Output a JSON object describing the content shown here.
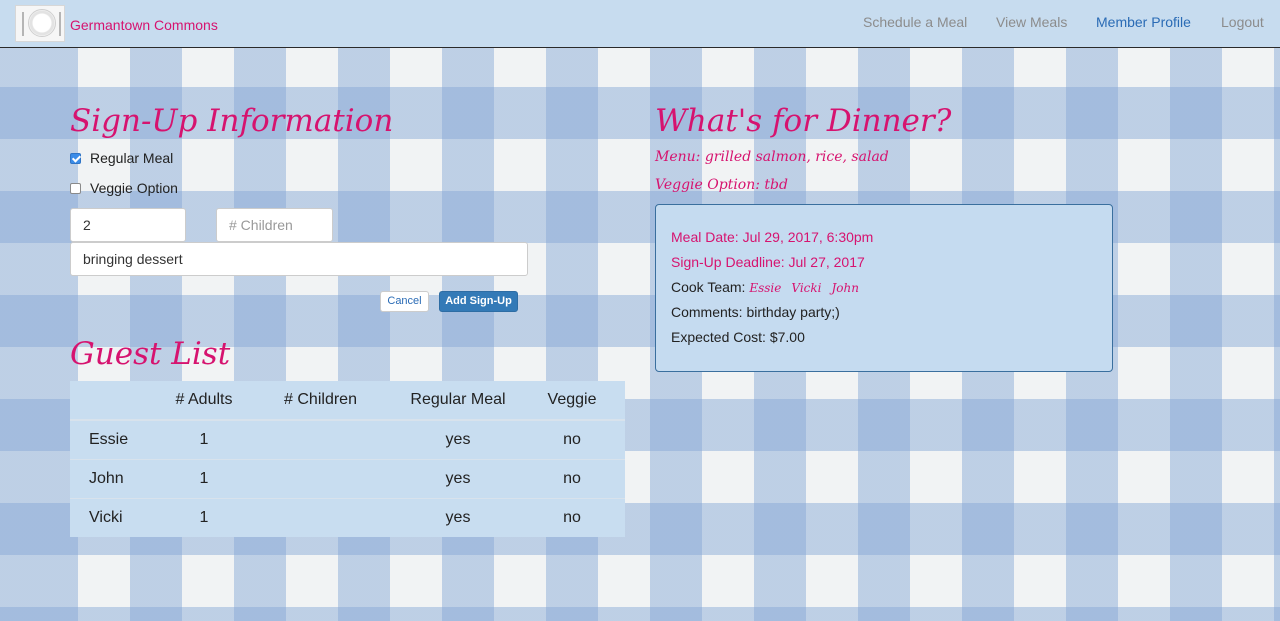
{
  "navbar": {
    "brand": "Germantown Commons",
    "links": [
      {
        "label": "Schedule a Meal"
      },
      {
        "label": "View Meals"
      },
      {
        "label": "Member Profile"
      },
      {
        "label": "Logout"
      }
    ],
    "active_link": "Member Profile"
  },
  "signup": {
    "title": "Sign-Up Information",
    "regular_meal_label": "Regular Meal",
    "regular_meal_checked": true,
    "veggie_label": "Veggie Option",
    "veggie_checked": false,
    "adults_value": "2",
    "children_placeholder": "# Children",
    "comment_value": "bringing dessert",
    "cancel_label": "Cancel",
    "submit_label": "Add Sign-Up"
  },
  "guests": {
    "title": "Guest List",
    "headers": [
      "",
      "# Adults",
      "# Children",
      "Regular Meal",
      "Veggie"
    ],
    "rows": [
      {
        "name": "Essie",
        "adults": "1",
        "children": "",
        "regular": "yes",
        "veggie": "no"
      },
      {
        "name": "John",
        "adults": "1",
        "children": "",
        "regular": "yes",
        "veggie": "no"
      },
      {
        "name": "Vicki",
        "adults": "1",
        "children": "",
        "regular": "yes",
        "veggie": "no"
      }
    ]
  },
  "dinner": {
    "title": "What's for Dinner?",
    "menu": "Menu: grilled salmon, rice, salad",
    "veggie": "Veggie Option: tbd",
    "meal_date": "Meal Date: Jul 29, 2017, 6:30pm",
    "deadline": "Sign-Up Deadline: Jul 27, 2017",
    "cook_team_label": "Cook Team:",
    "cook_team": [
      "Essie",
      "Vicki",
      "John"
    ],
    "comments": "Comments: birthday party;)",
    "cost": "Expected Cost: $7.00"
  },
  "colors": {
    "accent_pink": "#d6136f",
    "navbar_bg": "#c7dcef",
    "link_active": "#2a6bb5",
    "primary_button": "#337ab7"
  }
}
